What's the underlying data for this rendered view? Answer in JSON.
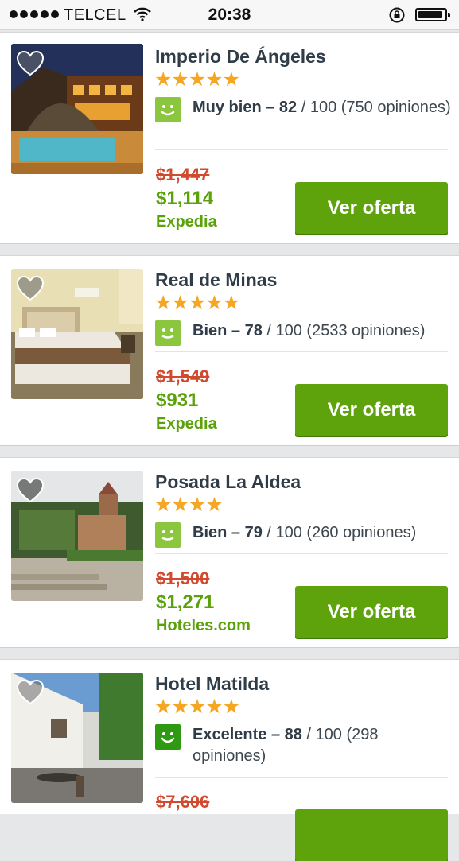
{
  "status_bar": {
    "carrier": "TELCEL",
    "time": "20:38",
    "icons": [
      "signal-dots-icon",
      "wifi-icon",
      "rotation-lock-icon",
      "battery-icon"
    ]
  },
  "colors": {
    "price_old": "#d14a2e",
    "price_new": "#5aa10a",
    "button": "#5ea30b",
    "stars": "#f5a623",
    "rating_good": "#8cc63f",
    "rating_excellent": "#2e9a12"
  },
  "hotels": [
    {
      "name": "Imperio De Ángeles",
      "stars": "★★★★★",
      "star_count": 5,
      "rating_label": "Muy bien – 82",
      "rating_rest": " / 100 (750 opiniones)",
      "old_price": "$1,447",
      "price": "$1,114",
      "provider": "Expedia",
      "button": "Ver oferta"
    },
    {
      "name": "Real de Minas",
      "stars": "★★★★★",
      "star_count": 5,
      "rating_label": "Bien – 78",
      "rating_rest": " / 100 (2533 opiniones)",
      "old_price": "$1,549",
      "price": "$931",
      "provider": "Expedia",
      "button": "Ver oferta"
    },
    {
      "name": "Posada La Aldea",
      "stars": "★★★★",
      "star_count": 4,
      "rating_label": "Bien – 79",
      "rating_rest": " / 100 (260 opiniones)",
      "old_price": "$1,500",
      "price": "$1,271",
      "provider": "Hoteles.com",
      "button": "Ver oferta"
    },
    {
      "name": "Hotel Matilda",
      "stars": "★★★★★",
      "star_count": 5,
      "rating_label": "Excelente – 88",
      "rating_rest": " / 100 (298 opiniones)",
      "old_price": "$7,606",
      "price": "",
      "provider": "",
      "button": ""
    }
  ]
}
